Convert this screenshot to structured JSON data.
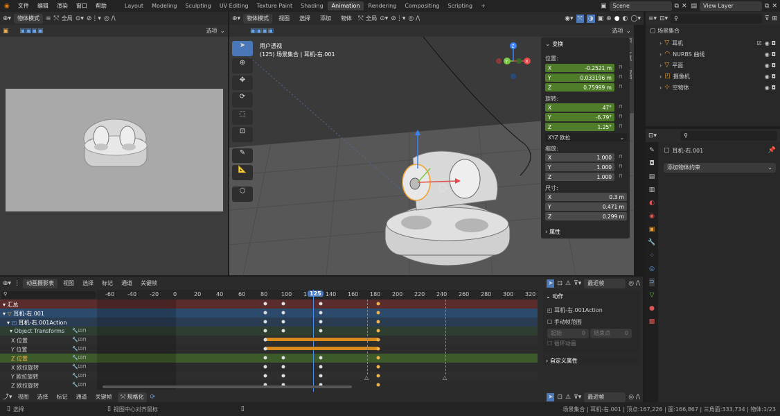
{
  "menu": [
    "文件",
    "编辑",
    "渲染",
    "窗口",
    "帮助"
  ],
  "workspaces": [
    "Layout",
    "Modeling",
    "Sculpting",
    "UV Editing",
    "Texture Paint",
    "Shading",
    "Animation",
    "Rendering",
    "Compositing",
    "Scripting",
    "+"
  ],
  "active_workspace": "Animation",
  "scene": "Scene",
  "view_layer": "View Layer",
  "left_viewport": {
    "mode": "物体模式",
    "orient": "全局",
    "options": "选项"
  },
  "main_viewport": {
    "mode": "物体模式",
    "orient": "全局",
    "options": "选项",
    "menus": [
      "视图",
      "选择",
      "添加",
      "物体"
    ],
    "overlay_title": "用户透视",
    "overlay_sub": "(125) 场景集合 | 耳机-右.001"
  },
  "npanel": {
    "transform": "变换",
    "location_label": "位置:",
    "loc": {
      "x": "-0.2521 m",
      "y": "0.033196 m",
      "z": "0.75999 m"
    },
    "rotation_label": "旋转:",
    "rot": {
      "x": "47°",
      "y": "-6.79°",
      "z": "1.25°"
    },
    "rot_mode": "XYZ 欧拉",
    "scale_label": "缩放:",
    "scale": {
      "x": "1.000",
      "y": "1.000",
      "z": "1.000"
    },
    "dims_label": "尺寸:",
    "dims": {
      "x": "0.3 m",
      "y": "0.471 m",
      "z": "0.299 m"
    },
    "props": "属性",
    "tabs": [
      "项",
      "工具",
      "视图"
    ]
  },
  "outliner": {
    "root": "场景集合",
    "items": [
      {
        "name": "耳机",
        "icon": "mesh"
      },
      {
        "name": "NURBS 曲线",
        "icon": "curve"
      },
      {
        "name": "平面",
        "icon": "mesh"
      },
      {
        "name": "摄像机",
        "icon": "camera"
      },
      {
        "name": "空物体",
        "icon": "empty"
      }
    ]
  },
  "properties": {
    "object": "耳机-右.001",
    "constraint": "添加物体约束"
  },
  "timeline": {
    "editor": "动画摄影表",
    "menus": [
      "视图",
      "选择",
      "标记",
      "通道",
      "关键帧"
    ],
    "snap": "最近帧",
    "current_frame": "125",
    "ticks": [
      "-60",
      "-40",
      "-20",
      "0",
      "20",
      "40",
      "60",
      "80",
      "100",
      "1",
      "140",
      "160",
      "180",
      "200",
      "220",
      "240",
      "260",
      "280",
      "300",
      "320"
    ],
    "channels": [
      "汇总",
      "耳机-右.001",
      "耳机-右.001Action",
      "Object Transforms",
      "X 位置",
      "Y 位置",
      "Z 位置",
      "X 欧拉旋转",
      "Y 欧拉旋转",
      "Z 欧拉旋转"
    ],
    "side": {
      "action_title": "动作",
      "action_name": "耳机-右.001Action",
      "manual": "手动帧范围",
      "start_label": "起始",
      "start": "0",
      "end_label": "结束点",
      "end": "0",
      "cycle": "循环动画",
      "custom": "自定义属性"
    }
  },
  "bottom_hdr": {
    "menus": [
      "视图",
      "选择",
      "标记",
      "通道",
      "关键帧"
    ],
    "normalize": "规格化",
    "snap": "最近帧"
  },
  "status": {
    "select": "选择",
    "center": "视图中心对齐鼠标",
    "info": "场景集合 | 耳机-右.001 | 顶点:167,226 | 面:166,867 | 三角面:333,734 | 物体:1/23"
  }
}
